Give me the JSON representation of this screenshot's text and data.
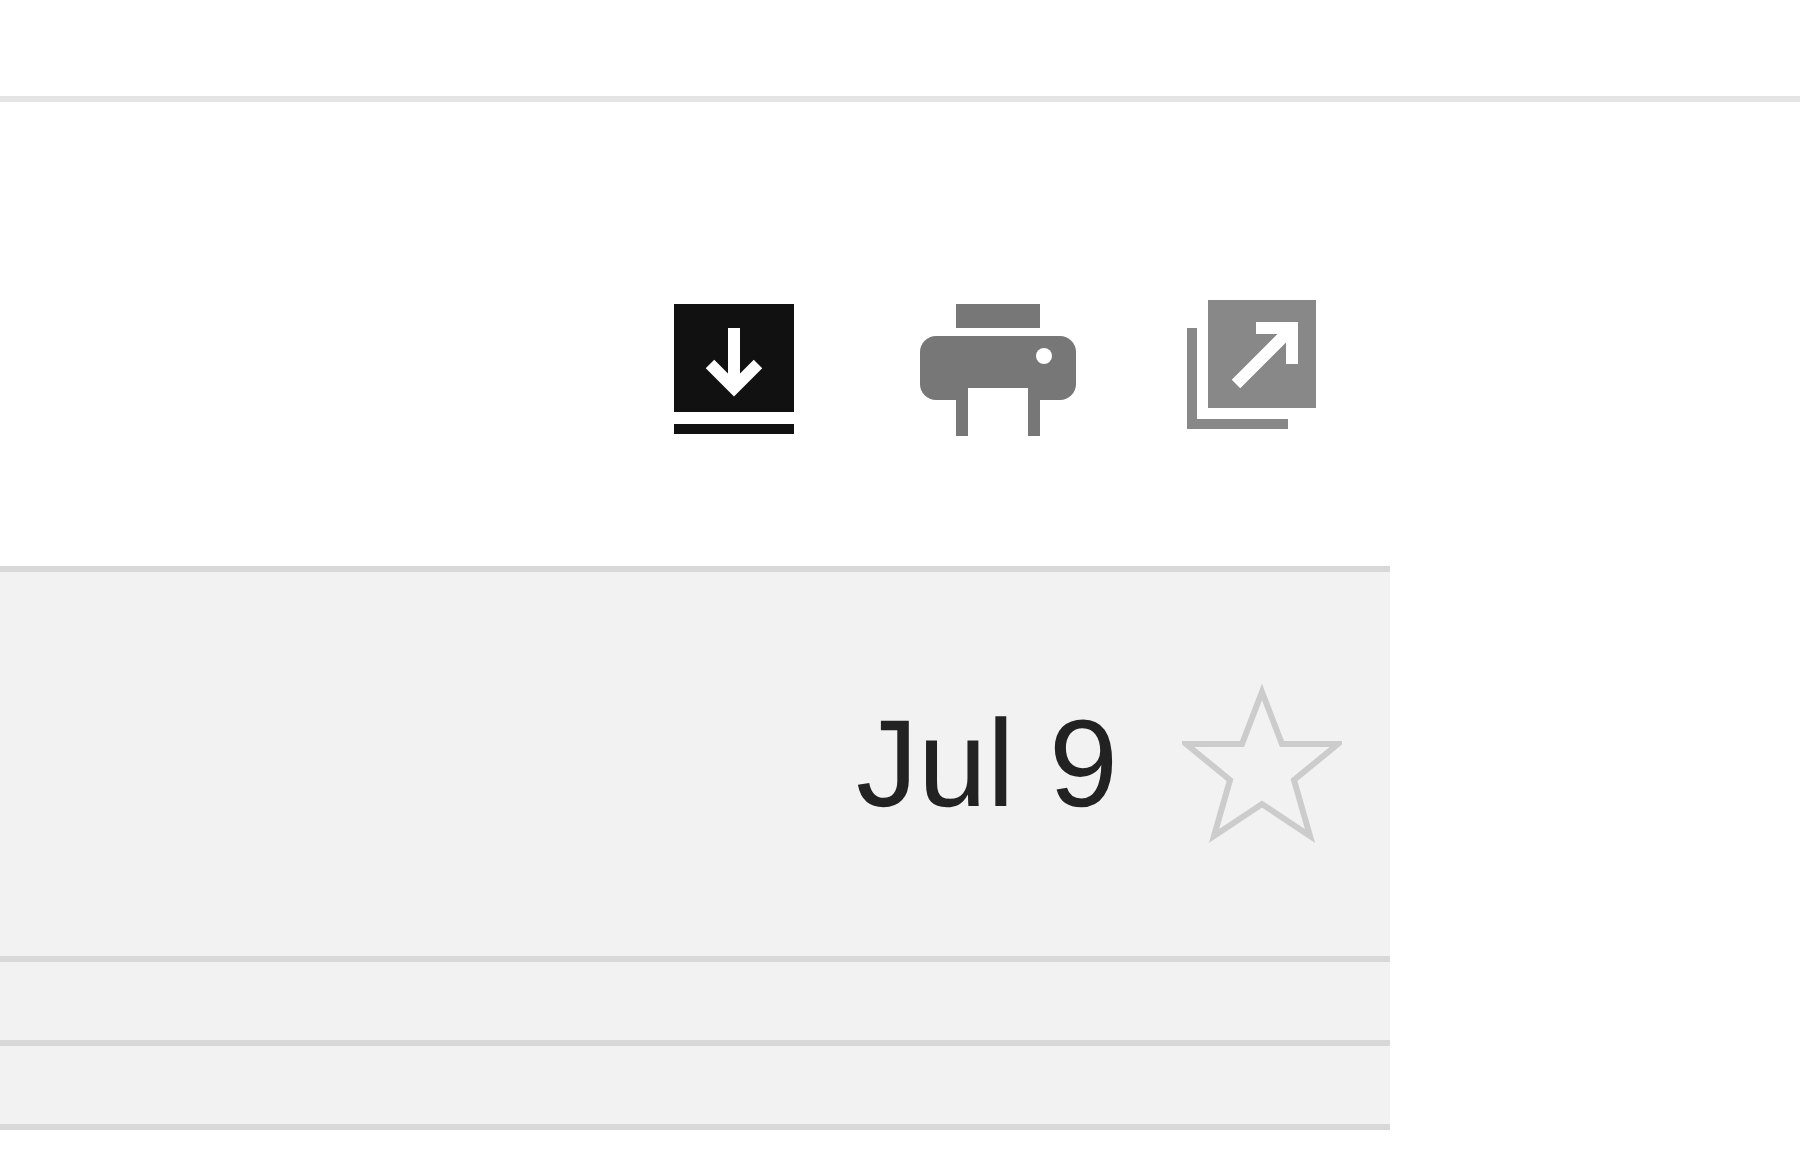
{
  "message": {
    "date": "Jul 9",
    "starred": false
  }
}
